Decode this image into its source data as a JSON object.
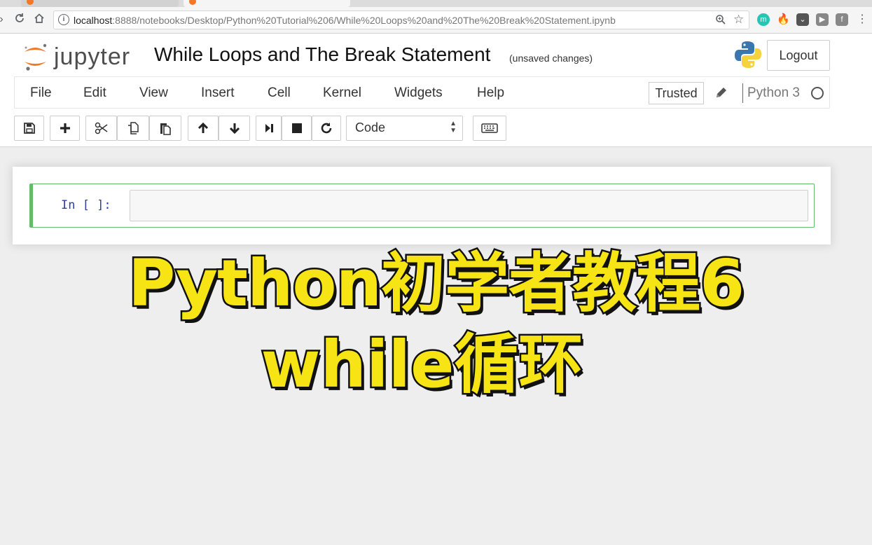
{
  "browser": {
    "url_host": "localhost",
    "url_rest": ":8888/notebooks/Desktop/Python%20Tutorial%206/While%20Loops%20and%20The%20Break%20Statement.ipynb"
  },
  "header": {
    "logo_text": "jupyter",
    "notebook_title": "While Loops and The Break Statement",
    "save_status": "(unsaved changes)",
    "logout_label": "Logout"
  },
  "menu": {
    "items": [
      "File",
      "Edit",
      "View",
      "Insert",
      "Cell",
      "Kernel",
      "Widgets",
      "Help"
    ],
    "trusted_label": "Trusted",
    "kernel_name": "Python 3"
  },
  "toolbar": {
    "cell_type": "Code"
  },
  "cell": {
    "prompt": "In [ ]:"
  },
  "overlay": {
    "line1": "Python初学者教程6",
    "line2": "while循环"
  },
  "colors": {
    "jupyter_orange": "#f37726",
    "cell_edit_border": "#66bb6a",
    "prompt_blue": "#303f9f",
    "caption_yellow": "#f6e415"
  }
}
